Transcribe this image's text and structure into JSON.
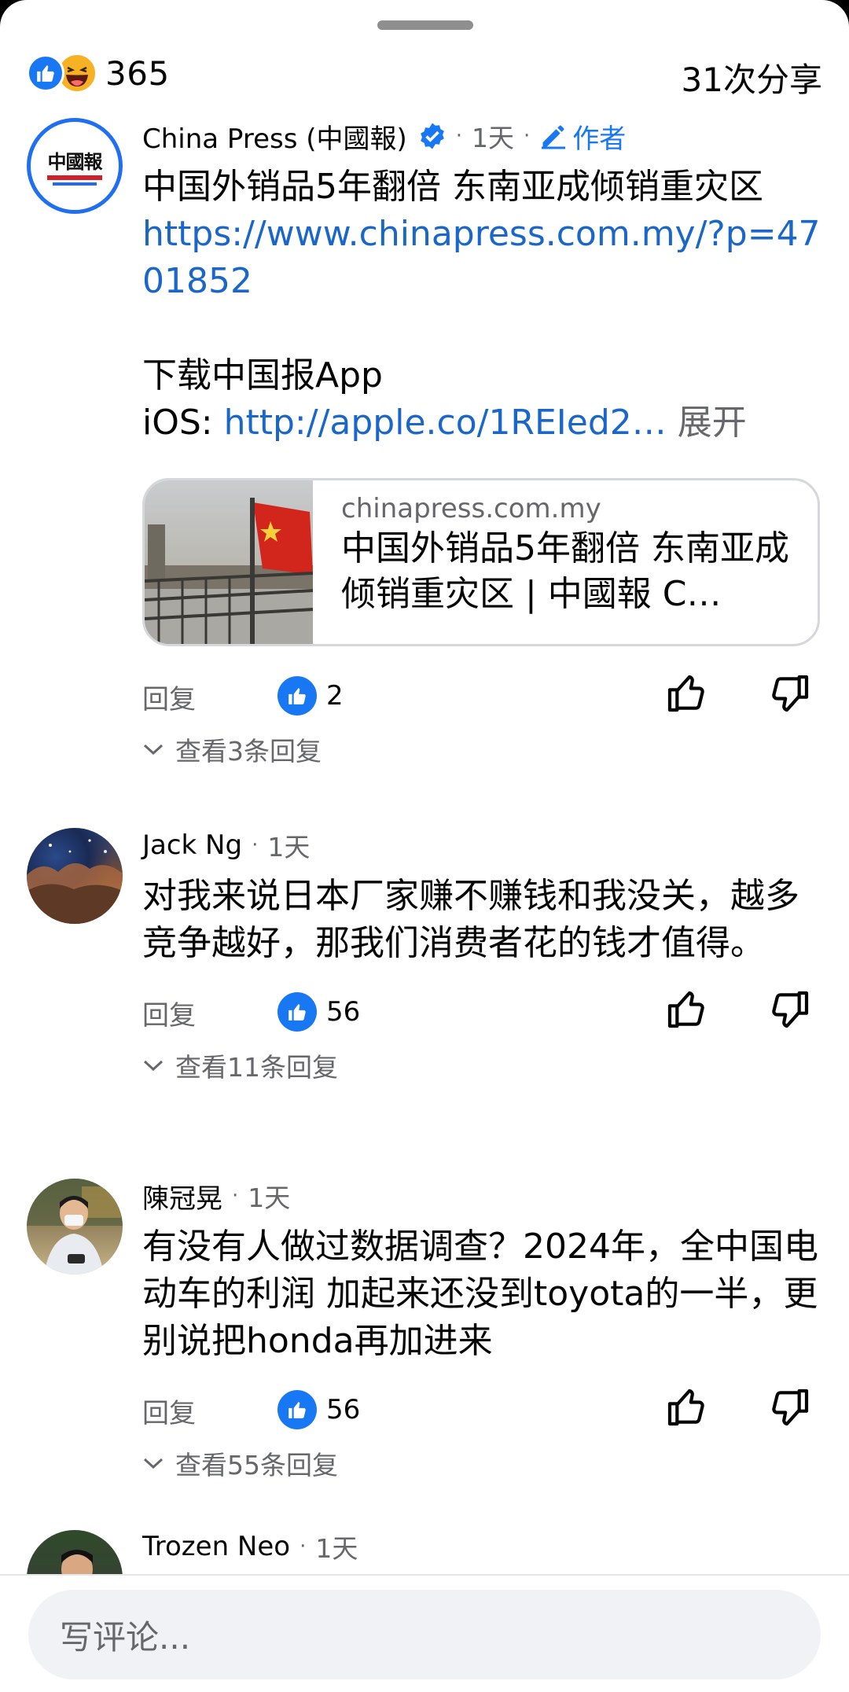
{
  "header": {
    "reaction_count": "365",
    "share_count": "31次分享"
  },
  "post_comment": {
    "author": "China Press (中國報)",
    "time": "1天",
    "author_badge": "作者",
    "logo_text": "中國報",
    "line1": "中国外销品5年翻倍 东南亚成倾销重灾区",
    "url": "https://www.chinapress.com.my/?p=4701852",
    "line2": "下载中国报App",
    "ios_label": "iOS: ",
    "ios_link": "http://apple.co/1REIed2…",
    "expand": "展开",
    "preview": {
      "domain": "chinapress.com.my",
      "title": "中国外销品5年翻倍 东南亚成倾销重灾区 | 中國報 C…"
    },
    "reply_label": "回复",
    "likes": "2",
    "view_replies": "查看3条回复"
  },
  "comments": [
    {
      "author": "Jack Ng",
      "time": "1天",
      "text": "对我来说日本厂家赚不赚钱和我没关，越多竞争越好，那我们消费者花的钱才值得。",
      "reply_label": "回复",
      "likes": "56",
      "view_replies": "查看11条回复"
    },
    {
      "author": "陳冠晃",
      "time": "1天",
      "text": "有没有人做过数据调查？2024年，全中国电动车的利润 加起来还没到toyota的一半，更别说把honda再加进来",
      "reply_label": "回复",
      "likes": "56",
      "view_replies": "查看55条回复"
    },
    {
      "author": "Trozen Neo",
      "time": "1天"
    }
  ],
  "composer": {
    "placeholder": "写评论..."
  },
  "colors": {
    "facebook_blue": "#1877f2",
    "link": "#1a66c9",
    "secondary_text": "#65676b"
  }
}
